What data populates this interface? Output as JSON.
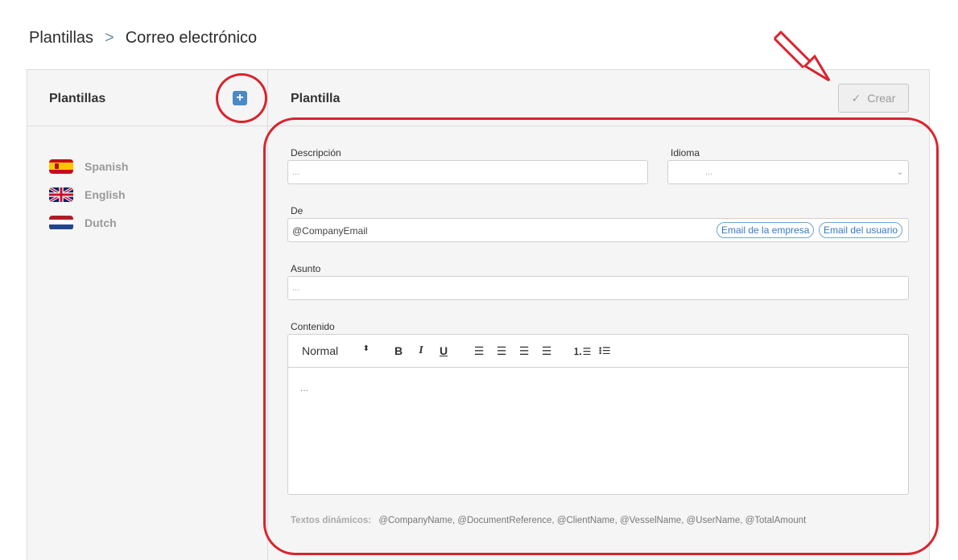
{
  "breadcrumb": {
    "root": "Plantillas",
    "current": "Correo electrónico"
  },
  "left": {
    "title": "Plantillas",
    "add_label": "+",
    "languages": [
      {
        "label": "Spanish",
        "flag": "spain-flag-icon"
      },
      {
        "label": "English",
        "flag": "uk-flag-icon"
      },
      {
        "label": "Dutch",
        "flag": "netherlands-flag-icon"
      }
    ]
  },
  "form": {
    "title": "Plantilla",
    "create_label": "Crear",
    "descripcion_label": "Descripción",
    "descripcion_placeholder": "...",
    "idioma_label": "Idioma",
    "idioma_value": "...",
    "de_label": "De",
    "de_value": "@CompanyEmail",
    "chip_company": "Email de la empresa",
    "chip_user": "Email del usuario",
    "asunto_label": "Asunto",
    "asunto_placeholder": "...",
    "contenido_label": "Contenido",
    "toolbar_format": "Normal",
    "editor_placeholder": "...",
    "dynamic_label": "Textos dinámicos:",
    "dynamic_values": "@CompanyName, @DocumentReference, @ClientName, @VesselName, @UserName, @TotalAmount"
  },
  "colors": {
    "accent": "#4a8ac4",
    "annotation": "#d9232d",
    "chip": "#3a7ab8"
  }
}
